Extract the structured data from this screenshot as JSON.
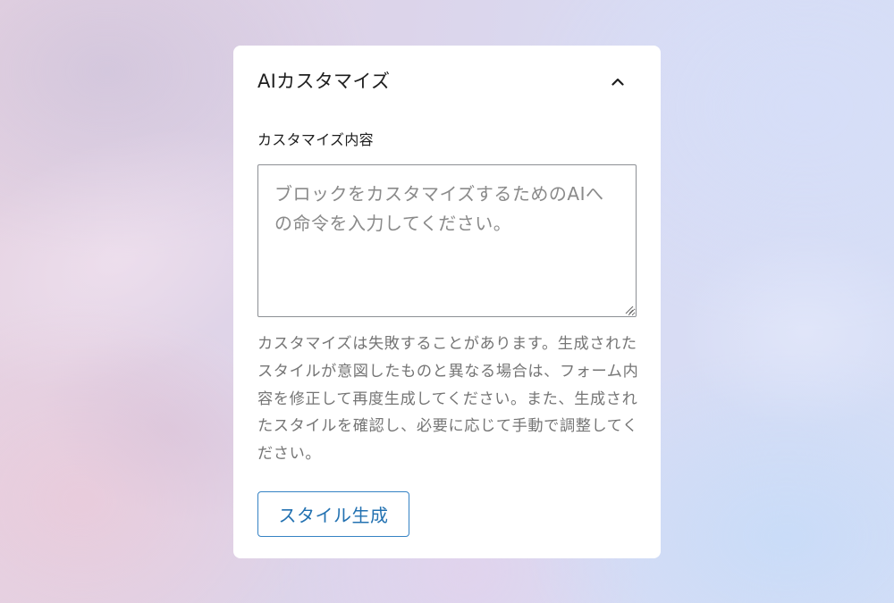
{
  "panel": {
    "title": "AIカスタマイズ",
    "toggle_icon": "chevron-up-icon",
    "expanded": true
  },
  "form": {
    "field_label": "カスタマイズ内容",
    "textarea": {
      "value": "",
      "placeholder": "ブロックをカスタマイズするためのAIへの命令を入力してください。"
    },
    "help_text": "カスタマイズは失敗することがあります。生成されたスタイルが意図したものと異なる場合は、フォーム内容を修正して再度生成してください。また、生成されたスタイルを確認し、必要に応じて手動で調整してください。",
    "generate_button_label": "スタイル生成"
  },
  "colors": {
    "accent": "#2271b1",
    "text": "#1e1e1e",
    "muted_text": "#757575",
    "input_border": "#8c8f94",
    "panel_background": "#ffffff"
  }
}
